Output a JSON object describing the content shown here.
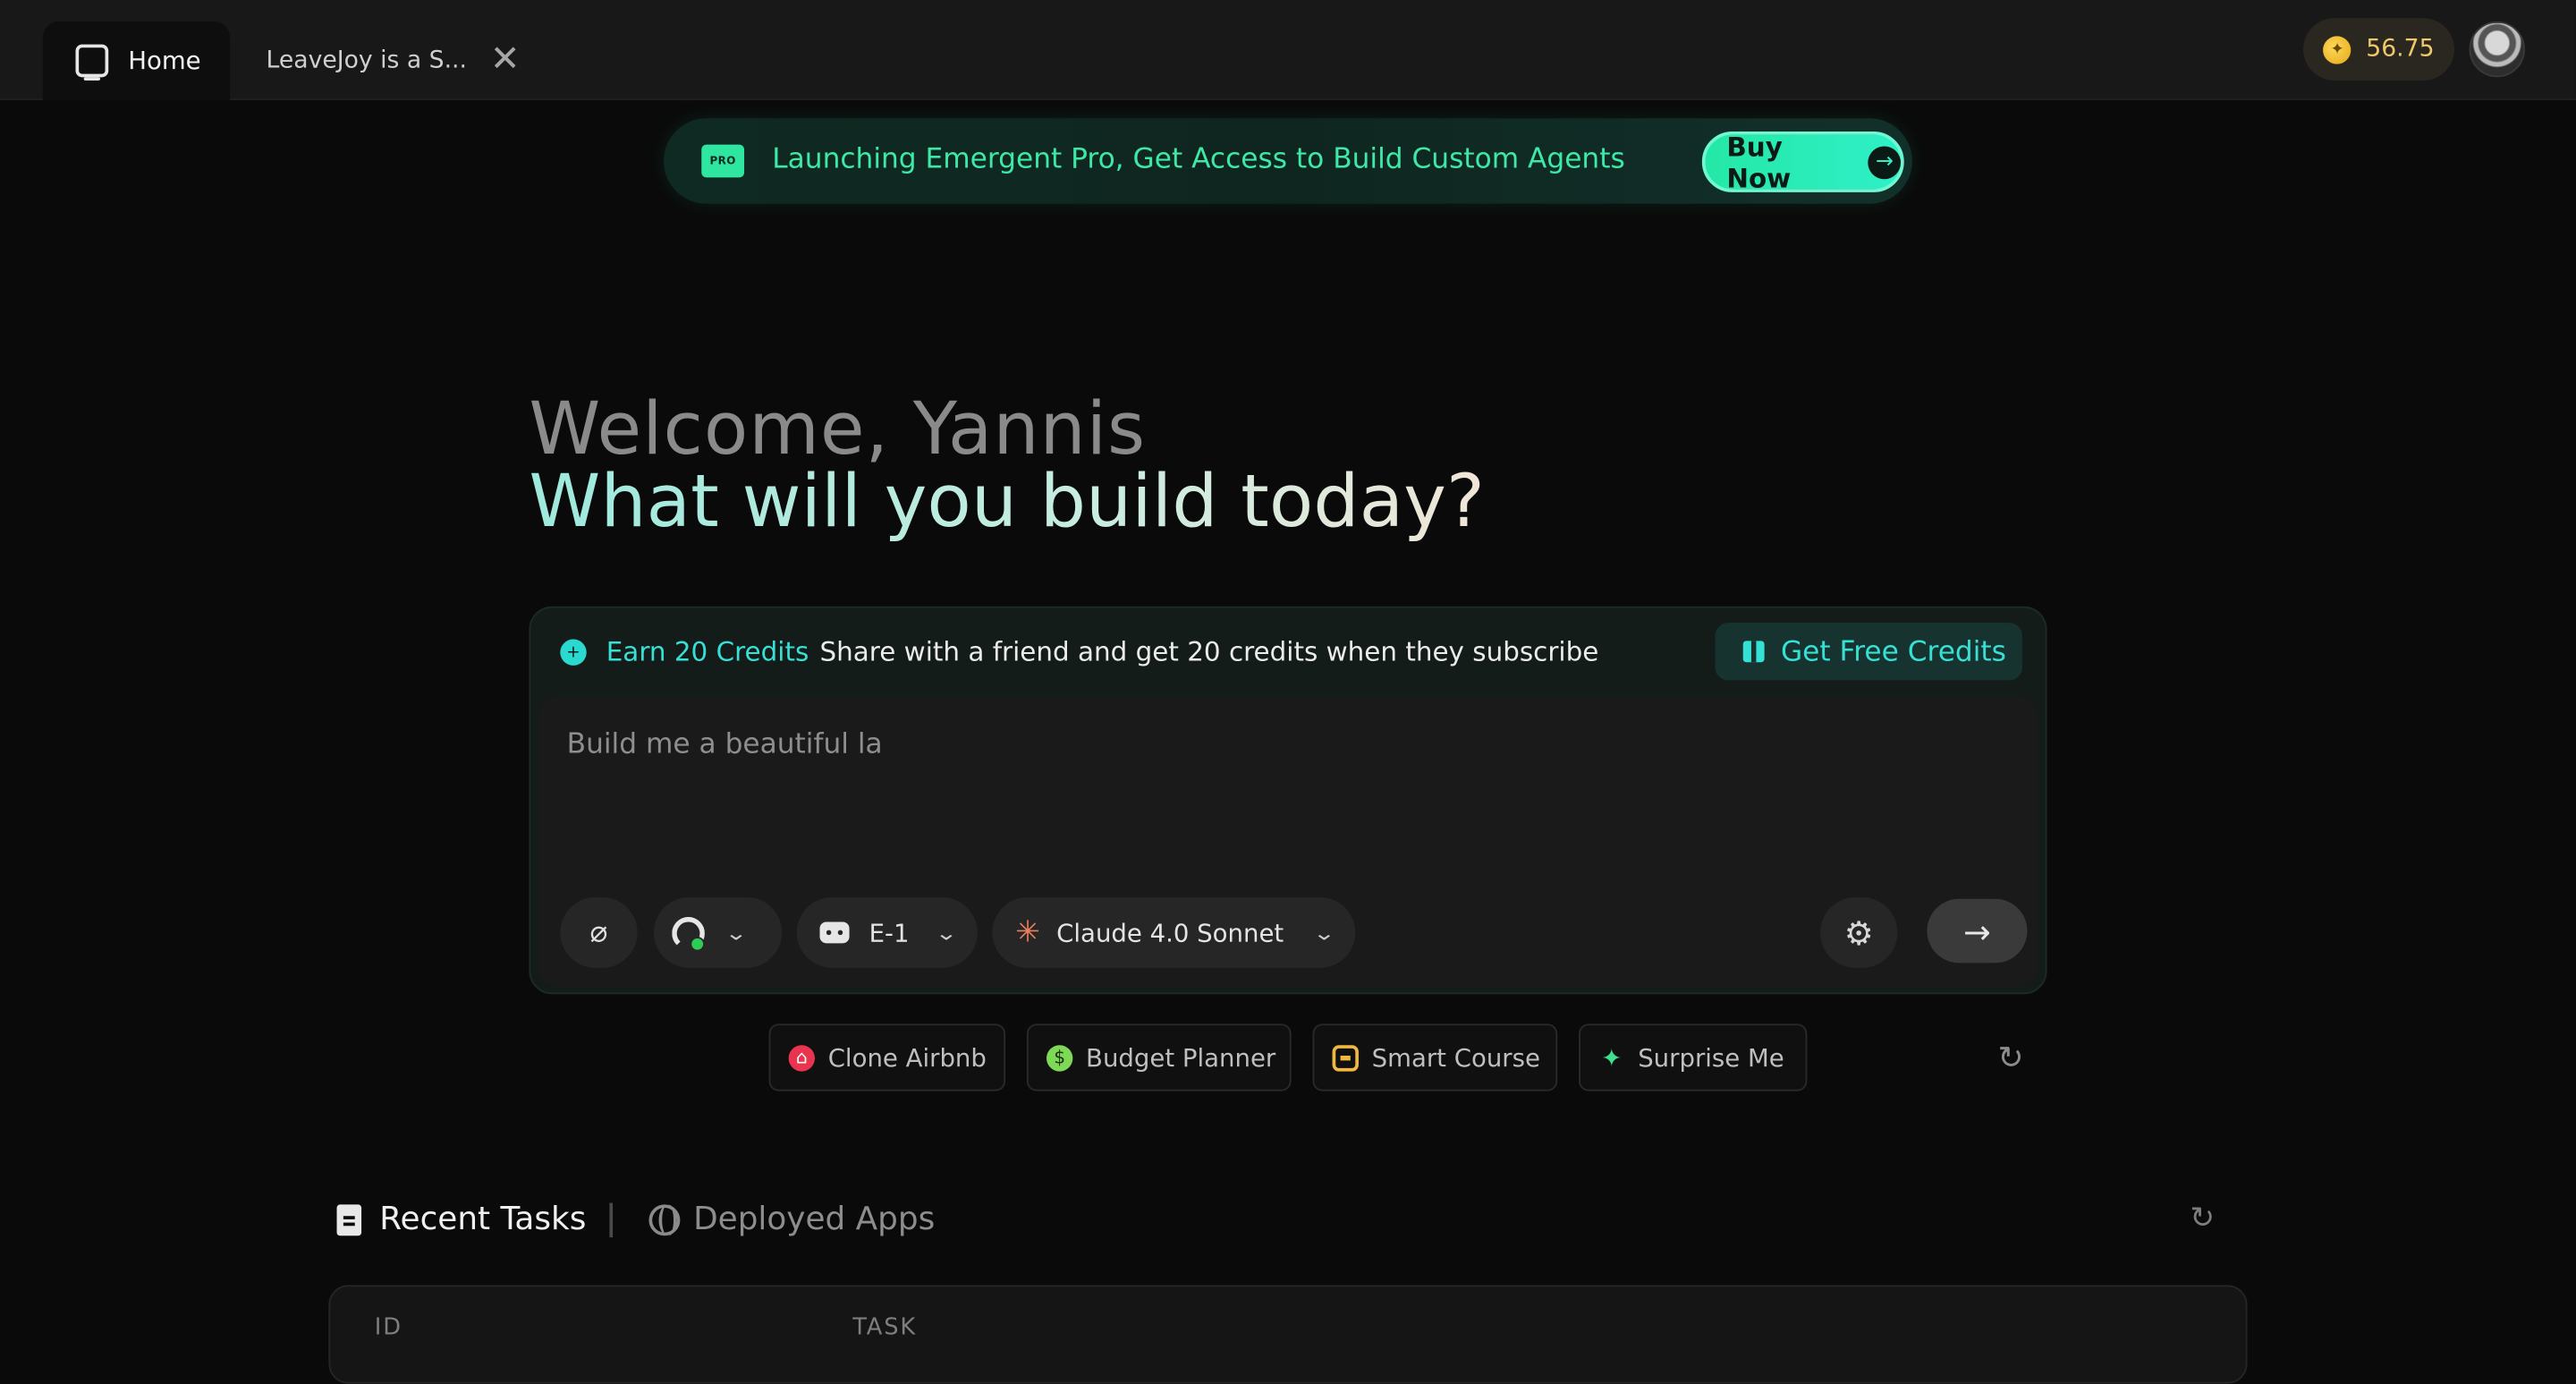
{
  "tabs": {
    "home_label": "Home",
    "task_label": "LeaveJoy is a S...",
    "close_glyph": "✕"
  },
  "account": {
    "credits": "56.75",
    "coin_color": "#f2b92a"
  },
  "promo": {
    "badge": "PRO",
    "text": "Launching Emergent Pro, Get Access to Build Custom Agents",
    "button_label": "Buy Now",
    "accent": "#2ee6a0"
  },
  "hero": {
    "welcome": "Welcome, Yannis",
    "question": "What will you build today?"
  },
  "referral": {
    "earn_label": "Earn 20 Credits",
    "description": "Share with a friend and get 20 credits when they subscribe",
    "button_label": "Get Free Credits",
    "accent": "#37e0d5"
  },
  "prompt": {
    "value": "Build me a beautiful la",
    "agent": "E-1",
    "model": "Claude 4.0 Sonnet"
  },
  "suggestions": [
    {
      "label": "Clone Airbnb",
      "icon": "airbnb-icon"
    },
    {
      "label": "Budget Planner",
      "icon": "piggy-bank-icon"
    },
    {
      "label": "Smart Course",
      "icon": "course-window-icon"
    },
    {
      "label": "Surprise Me",
      "icon": "sparkle-icon"
    }
  ],
  "tasks": {
    "recent_label": "Recent Tasks",
    "deployed_label": "Deployed Apps",
    "columns": [
      "ID",
      "TASK"
    ]
  }
}
